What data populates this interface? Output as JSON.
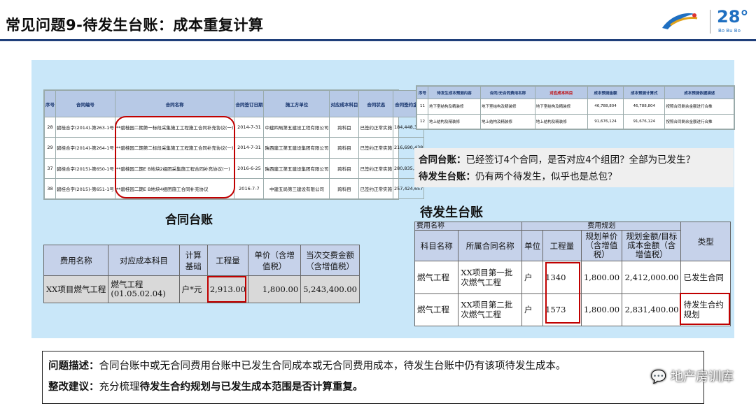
{
  "header": {
    "title": "常见问题9-待发生台账：成本重复计算",
    "logo_text": "28°",
    "logo_sub": "Bo Bu Bo"
  },
  "contract_shot": {
    "headers": [
      "序号",
      "合同编号",
      "合同名称",
      "合同签订日期",
      "施工方单位",
      "对应成本科目",
      "合同状态",
      "合同签约金额"
    ],
    "rows": [
      [
        "28",
        "碧桂合字(2014)-第263-1号",
        "**碧桂园二期第一标段采集施工工程施工合同补充协议(一)",
        "2014-7-31",
        "中建四局第五建设工程有限公司",
        "跨科目",
        "已签约正常实施",
        "184,448,369"
      ],
      [
        "29",
        "碧桂合字(2014)-第264-1号",
        "**碧桂园二期第二标段采集施工工程施工合同补充协议(一)",
        "2014-7-31",
        "陕西建工第五建设集团有限公司",
        "跨科目",
        "已签约正常实施",
        "216,690,438"
      ],
      [
        "37",
        "碧桂合字(2015)-第650-1号",
        "**碧桂园二期E  B地块2组团采集施工程合同补充协议(一)",
        "2016-6-25",
        "陕西建工第五建设集团有限公司",
        "跨科目",
        "已签约正常实施",
        "280,835,965"
      ],
      [
        "38",
        "碧桂合字(2015)-第651-1号",
        "**碧桂园二期E  B地块4组团施工合同补充协议",
        "2016-7-7",
        "中建五局第三建设有限公司",
        "跨科目",
        "已签约正常实施",
        "257,424,657"
      ]
    ]
  },
  "caption_contract": "合同台账",
  "cost_table": {
    "headers": [
      "费用名称",
      "对应成本科目",
      "计算基础",
      "工程量",
      "单价（含增值税）",
      "当次交费金额（含增值税）"
    ],
    "row": [
      "XX项目燃气工程",
      "燃气工程\n(01.05.02.04)",
      "户*元",
      "2,913.00",
      "1,800.00",
      "5,243,400.00"
    ]
  },
  "pending_shot": {
    "headers": [
      "序号",
      "待发生成本预测内容",
      "合同/无合同费用名称",
      "对应成本科目",
      "成本预测金额",
      "成本预测计算式",
      "成本预测依据描述"
    ],
    "rows": [
      [
        "11",
        "地下室结构及精装修",
        "地下室结构及精装修",
        "地下室结构及精装修",
        "46,788,804",
        "46,788,804",
        "按照合同剩余金额进行合推"
      ],
      [
        "12",
        "地上结构及精装修",
        "地上结构及精装修",
        "地上结构及精装修",
        "91,676,124",
        "91,676,124",
        "按照合同剩余金额进行合推"
      ]
    ]
  },
  "notes": {
    "line1_label": "合同台账：",
    "line1_text": "已经签订4个合同，是否对应4个组团？全部为已发生？",
    "line2_label": "待发生台账：",
    "line2_text": "仍有两个待发生，似乎也是总包？"
  },
  "caption_pending": "待发生台账",
  "pending_table": {
    "group_left": "费用名称",
    "group_right": "费用规划",
    "headers": [
      "科目名称",
      "所属合同名称",
      "单位",
      "工程量",
      "规划单价（含增值税）",
      "规划金额/目标成本金额（含增值税）",
      "类型"
    ],
    "rows": [
      [
        "燃气工程",
        "XX项目第一批次燃气工程",
        "户",
        "1340",
        "1,800.00",
        "2,412,000.00",
        "已发生合同"
      ],
      [
        "燃气工程",
        "XX项目第二批次燃气工程",
        "户",
        "1573",
        "1,800.00",
        "2,831,400.00",
        "待发生合约规划"
      ]
    ]
  },
  "bottom": {
    "problem_label": "问题描述：",
    "problem_text": "合同台账中或无合同费用台账中已发生合同成本或无合同费用成本，待发生台账中仍有该项待发生成本。",
    "advice_label": "整改建议：",
    "advice_pre": "充分梳理",
    "advice_bold": "待发生合约规划与已发生成本范围是否计算重复。"
  },
  "watermark": "地产房训库",
  "colors": {
    "title_rule": "#1f3f7a",
    "panel": "#c9e7f9",
    "highlight": "#c00000",
    "table_header": "#c6d2ea"
  }
}
